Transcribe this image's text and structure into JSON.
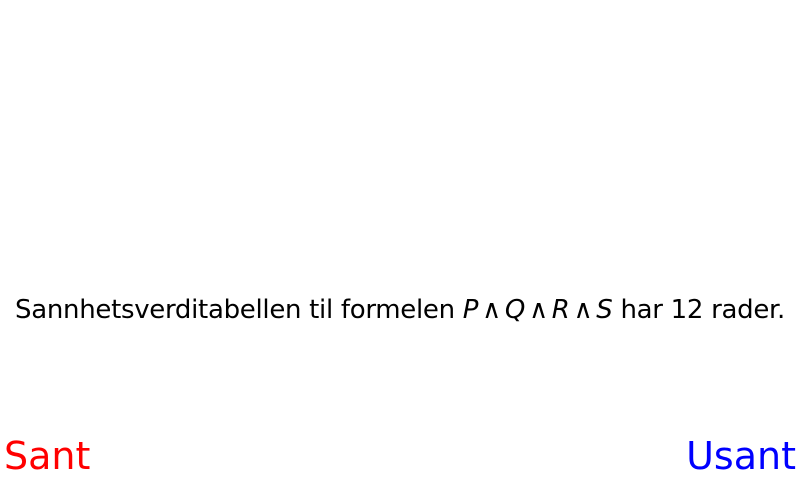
{
  "statement": {
    "prefix": "Sannhetsverditabellen til formelen",
    "formula": {
      "p": "P",
      "op1": "∧",
      "q": "Q",
      "op2": "∧",
      "r": "R",
      "op3": "∧",
      "s": "S"
    },
    "suffix": "har 12 rader."
  },
  "answers": {
    "true_label": "Sant",
    "false_label": "Usant",
    "true_color": "#ff0000",
    "false_color": "#0000ff"
  }
}
